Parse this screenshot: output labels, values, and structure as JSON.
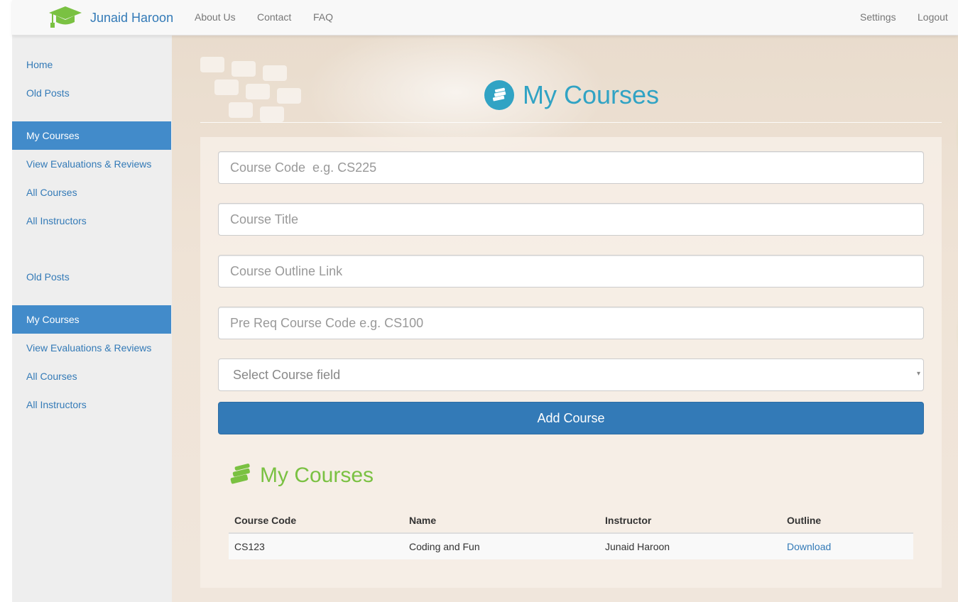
{
  "navbar": {
    "brand": "Junaid Haroon",
    "links": [
      "About Us",
      "Contact",
      "FAQ"
    ],
    "right_links": [
      "Settings",
      "Logout"
    ]
  },
  "sidebar": {
    "items": [
      {
        "label": "Home",
        "active": false
      },
      {
        "label": "Old Posts",
        "active": false
      },
      {
        "label": "My Courses",
        "active": true
      },
      {
        "label": "View Evaluations & Reviews",
        "active": false
      },
      {
        "label": "All Courses",
        "active": false
      },
      {
        "label": "All Instructors",
        "active": false
      },
      {
        "label": "Old Posts",
        "active": false
      },
      {
        "label": "My Courses",
        "active": true
      },
      {
        "label": "View Evaluations & Reviews",
        "active": false
      },
      {
        "label": "All Courses",
        "active": false
      },
      {
        "label": "All Instructors",
        "active": false
      }
    ]
  },
  "page": {
    "title": "My Courses",
    "title_icon": "books-icon"
  },
  "form": {
    "course_code_placeholder": "Course Code  e.g. CS225",
    "course_title_placeholder": "Course Title",
    "outline_link_placeholder": "Course Outline Link",
    "prereq_placeholder": "Pre Req Course Code e.g. CS100",
    "field_select": "Select Course field",
    "submit_label": "Add Course"
  },
  "courses": {
    "title": "My Courses",
    "headers": [
      "Course Code",
      "Name",
      "Instructor",
      "Outline"
    ],
    "rows": [
      {
        "code": "CS123",
        "name": "Coding and Fun",
        "instructor": "Junaid Haroon",
        "outline": "Download"
      }
    ]
  },
  "colors": {
    "brand_green": "#7ac142",
    "title_teal": "#31a3c4",
    "primary": "#337ab7",
    "sidebar_active": "#428bca"
  }
}
